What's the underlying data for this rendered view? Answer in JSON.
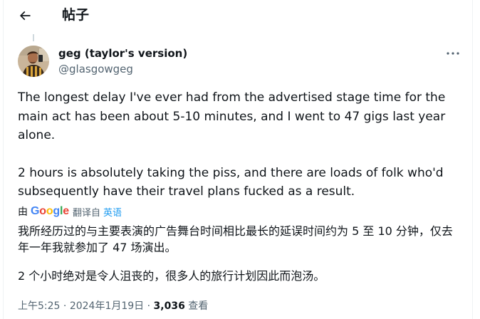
{
  "header": {
    "title": "帖子",
    "back_icon": "arrow-left-icon"
  },
  "author": {
    "display_name": "geg (taylor's version)",
    "handle": "@glasgowgeg",
    "more_icon": "more-horizontal-icon"
  },
  "tweet": {
    "paragraphs": [
      "The longest delay I've ever had from the advertised stage time for the main act has been about 5-10 minutes, and I went to 47 gigs last year alone.",
      "2 hours is absolutely taking the piss, and there are loads of folk who'd subsequently have their travel plans fucked as a result."
    ]
  },
  "translation": {
    "by_label": "由",
    "provider": {
      "letters": [
        "G",
        "o",
        "o",
        "g",
        "l",
        "e"
      ]
    },
    "from_label": "翻译自",
    "source_language": "英语",
    "paragraphs": [
      "我所经历过的与主要表演的广告舞台时间相比最长的延误时间约为 5 至 10 分钟，仅去年一年我就参加了 47 场演出。",
      "2 个小时绝对是令人沮丧的，很多人的旅行计划因此而泡汤。"
    ]
  },
  "meta": {
    "time": "上午5:25",
    "separator": " · ",
    "date": "2024年1月19日",
    "views_count": "3,036",
    "views_label": " 查看"
  },
  "colors": {
    "text": "#0f1419",
    "secondary": "#536471",
    "link": "#1d9bf0",
    "google_blue": "#4285f4",
    "google_red": "#ea4335",
    "google_yellow": "#fbbc05",
    "google_green": "#34a853"
  }
}
